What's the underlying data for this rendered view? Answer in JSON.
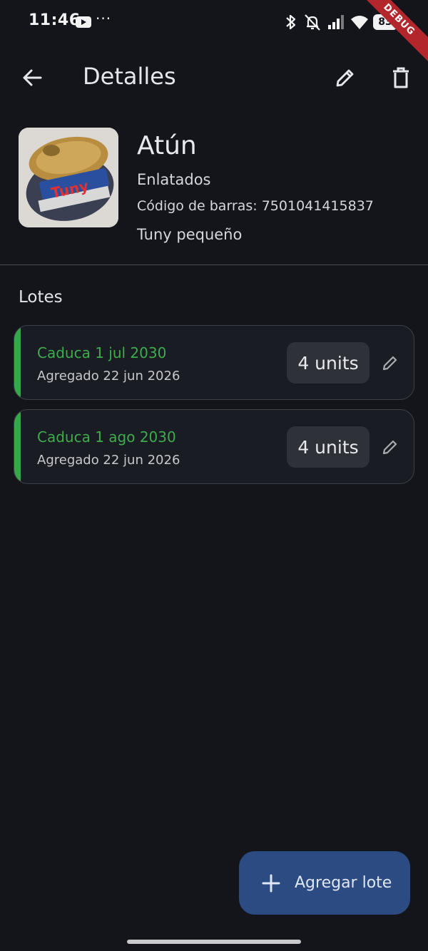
{
  "status_bar": {
    "time": "11:46",
    "battery": "83",
    "icons": [
      "youtube-icon",
      "more-icon",
      "bluetooth-icon",
      "alarm-off-icon",
      "signal-icon",
      "wifi-icon",
      "battery-icon"
    ]
  },
  "debug_banner": "DEBUG",
  "app_bar": {
    "title": "Detalles",
    "icons": [
      "back-arrow-icon",
      "edit-icon",
      "delete-icon"
    ]
  },
  "product": {
    "name": "Atún",
    "category": "Enlatados",
    "barcode": "Código de barras: 7501041415837",
    "description": "Tuny pequeño",
    "image_alt": "Tuny"
  },
  "lots_section": {
    "title": "Lotes",
    "items": [
      {
        "expiry": "Caduca 1 jul 2030",
        "added": "Agregado 22 jun 2026",
        "quantity": "4 units",
        "accent_color": "#3aa64a"
      },
      {
        "expiry": "Caduca 1 ago 2030",
        "added": "Agregado 22 jun 2026",
        "quantity": "4 units",
        "accent_color": "#3aa64a"
      }
    ]
  },
  "fab": {
    "label": "Agregar lote",
    "icon": "plus-icon"
  },
  "colors": {
    "background": "#13151b",
    "card": "#1a1c23",
    "accent_green": "#3aa64a",
    "fab": "#2c4b82"
  }
}
